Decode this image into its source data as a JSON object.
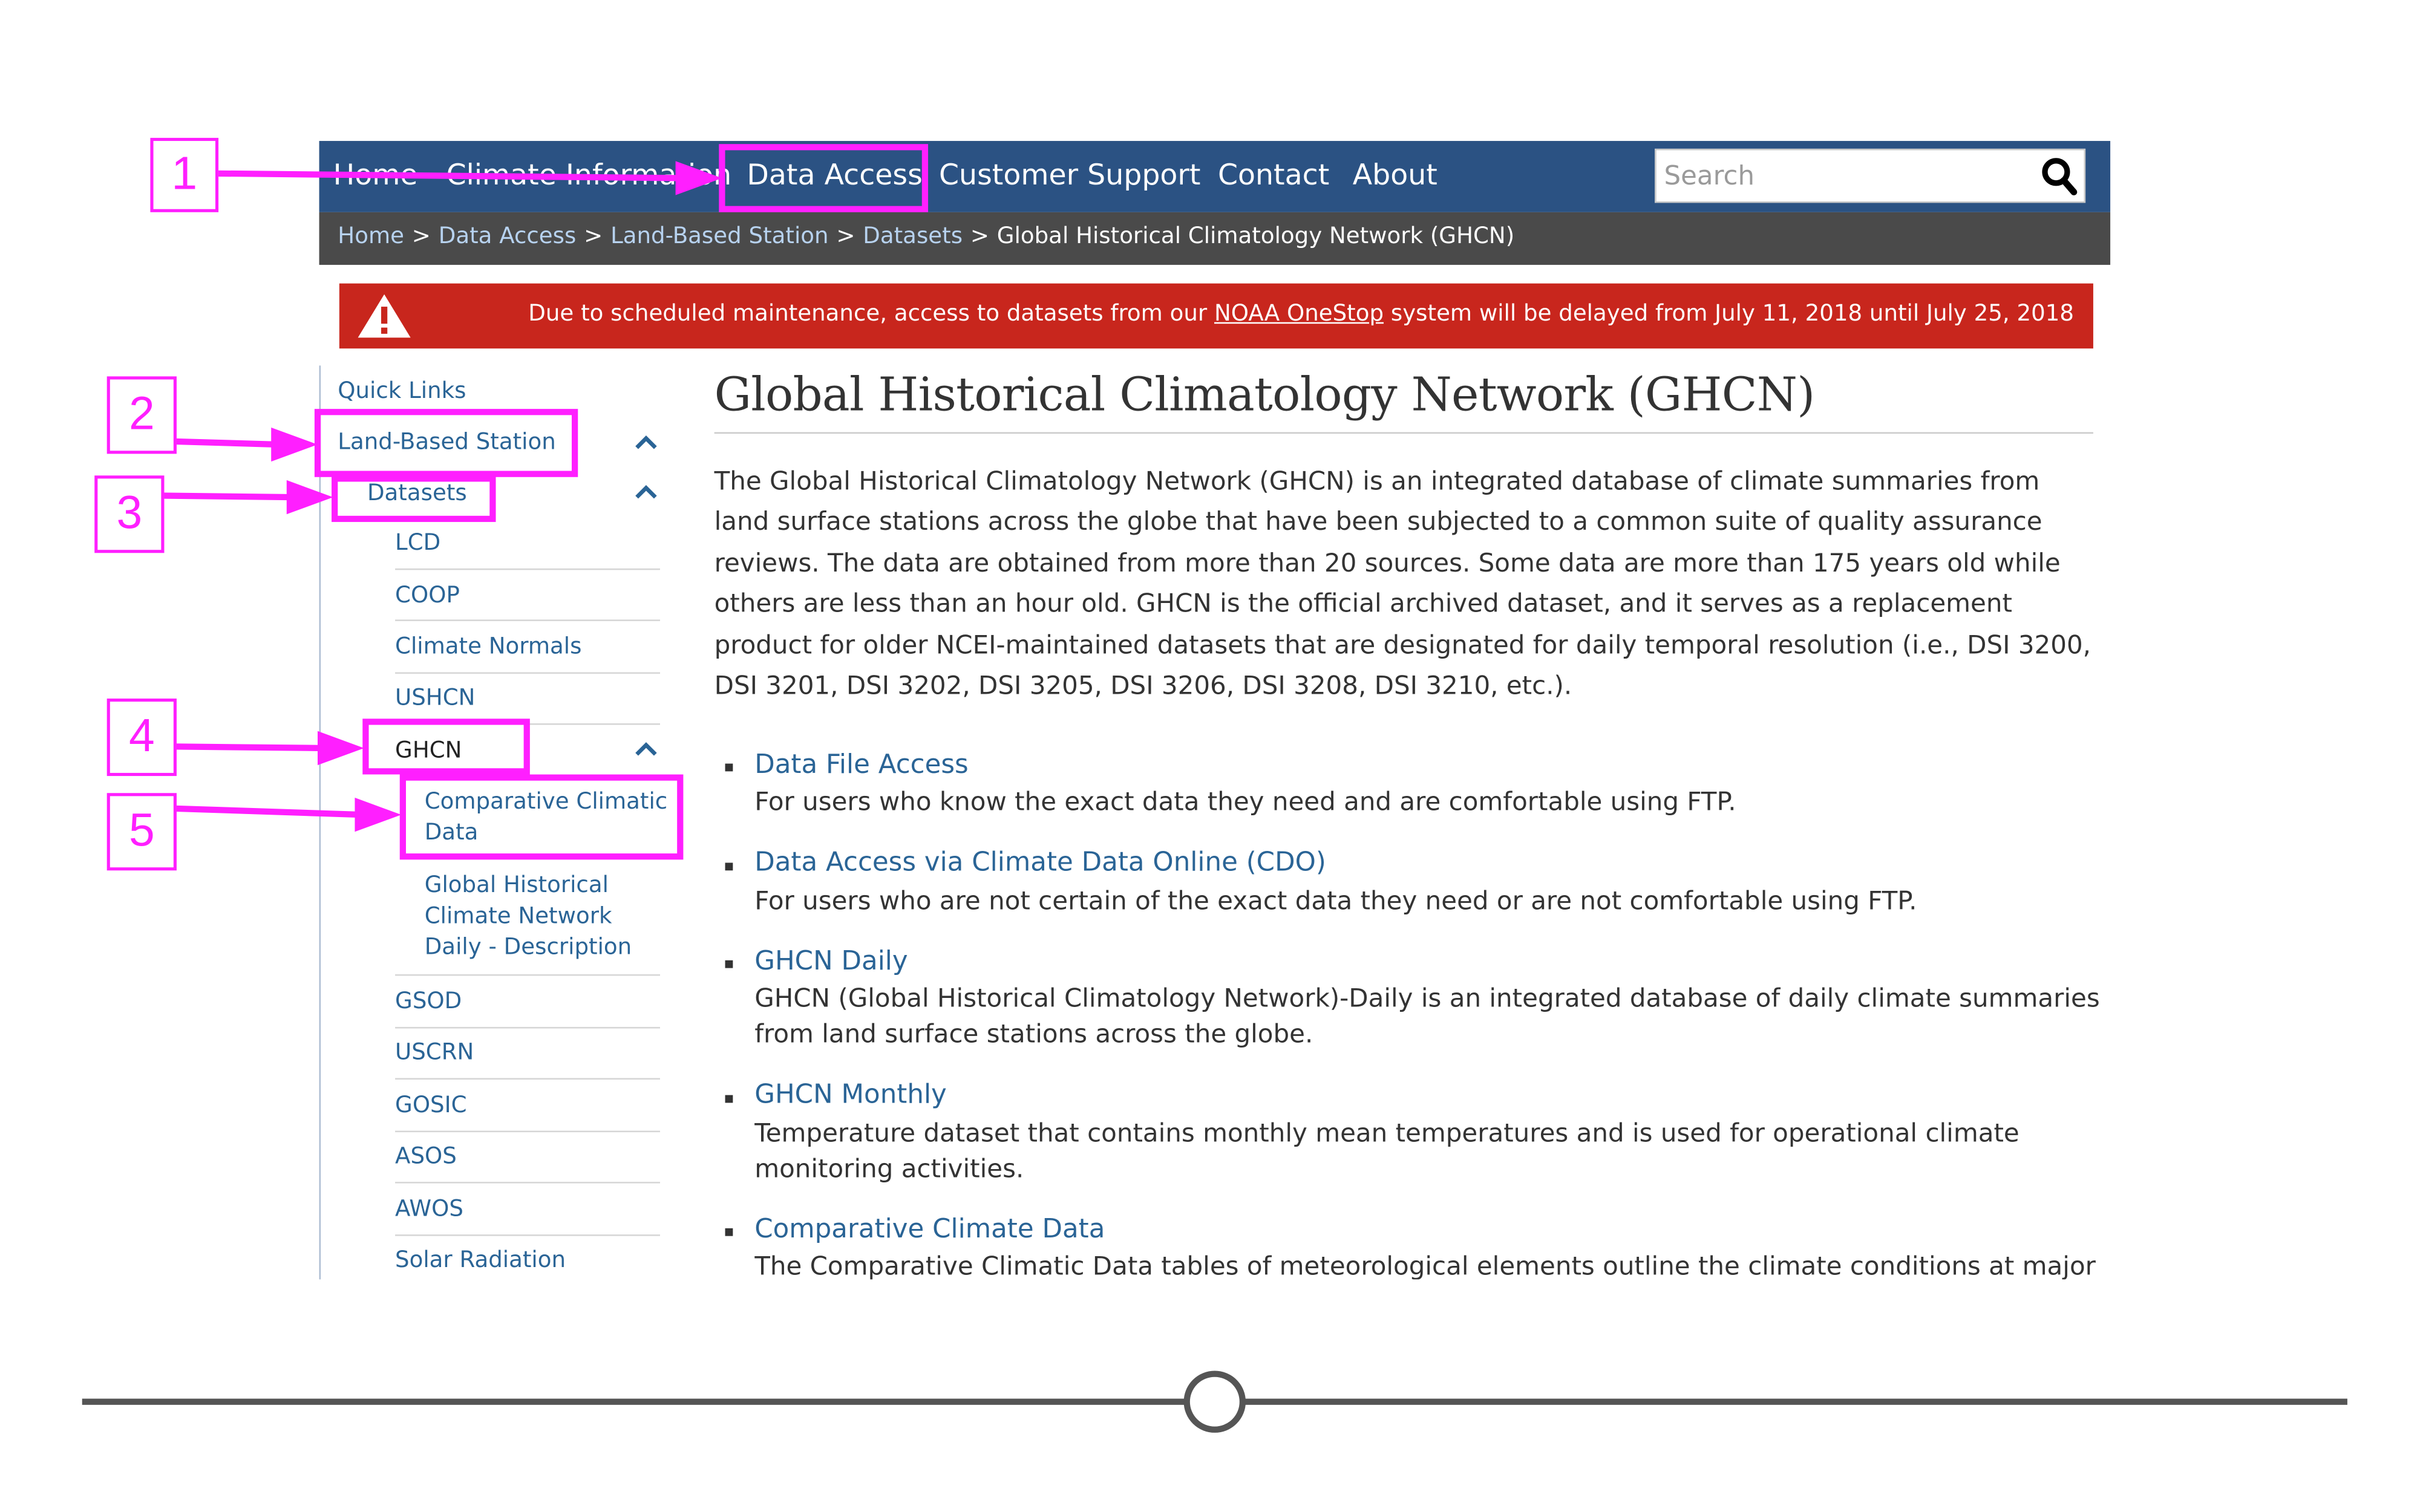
{
  "nav": {
    "items": [
      "Home",
      "Climate Information",
      "Data Access",
      "Customer Support",
      "Contact",
      "About"
    ],
    "search_placeholder": "Search"
  },
  "breadcrumb": {
    "links": [
      "Home",
      "Data Access",
      "Land-Based Station",
      "Datasets"
    ],
    "separator": ">",
    "current": "Global Historical Climatology Network (GHCN)"
  },
  "alert": {
    "text_before": "Due to scheduled maintenance, access to datasets from our ",
    "link": "NOAA OneStop",
    "text_after": " system will be delayed from July 11, 2018 until July 25, 2018"
  },
  "sidebar": {
    "quick_links": "Quick Links",
    "land_based_station": "Land-Based Station",
    "datasets": "Datasets",
    "items": [
      "LCD",
      "COOP",
      "Climate Normals",
      "USHCN",
      "GHCN",
      "GSOD",
      "USCRN",
      "GOSIC",
      "ASOS",
      "AWOS",
      "Solar Radiation"
    ],
    "ghcn_children": [
      "Comparative Climatic Data",
      "Global Historical Climate Network Daily - Description"
    ]
  },
  "main": {
    "title": "Global Historical Climatology Network (GHCN)",
    "intro": "The Global Historical Climatology Network (GHCN) is an integrated database of climate summaries from land surface stations across the globe that have been subjected to a common suite of quality assurance reviews. The data are obtained from more than 20 sources. Some data are more than 175 years old while others are less than an hour old. GHCN is the official archived dataset, and it serves as a replacement product for older NCEI-maintained datasets that are designated for daily temporal resolution (i.e., DSI 3200, DSI 3201, DSI 3202, DSI 3205, DSI 3206, DSI 3208, DSI 3210, etc.).",
    "resources": [
      {
        "title": "Data File Access",
        "desc": "For users who know the exact data they need and are comfortable using FTP."
      },
      {
        "title": "Data Access via Climate Data Online (CDO)",
        "desc": "For users who are not certain of the exact data they need or are not comfortable using FTP."
      },
      {
        "title": "GHCN Daily",
        "desc": "GHCN (Global Historical Climatology Network)-Daily is an integrated database of daily climate summaries from land surface stations across the globe."
      },
      {
        "title": "GHCN Monthly",
        "desc": "Temperature dataset that contains monthly mean temperatures and is used for operational climate monitoring activities."
      },
      {
        "title": "Comparative Climate Data",
        "desc": "The Comparative Climatic Data tables of meteorological elements outline the climate conditions at major"
      }
    ]
  },
  "annotations": [
    "1",
    "2",
    "3",
    "4",
    "5"
  ],
  "colors": {
    "nav_bg": "#2b5283",
    "breadcrumb_bg": "#4a4a4a",
    "alert_bg": "#c8261d",
    "link": "#2a6496",
    "annotation": "#ff1fff"
  }
}
